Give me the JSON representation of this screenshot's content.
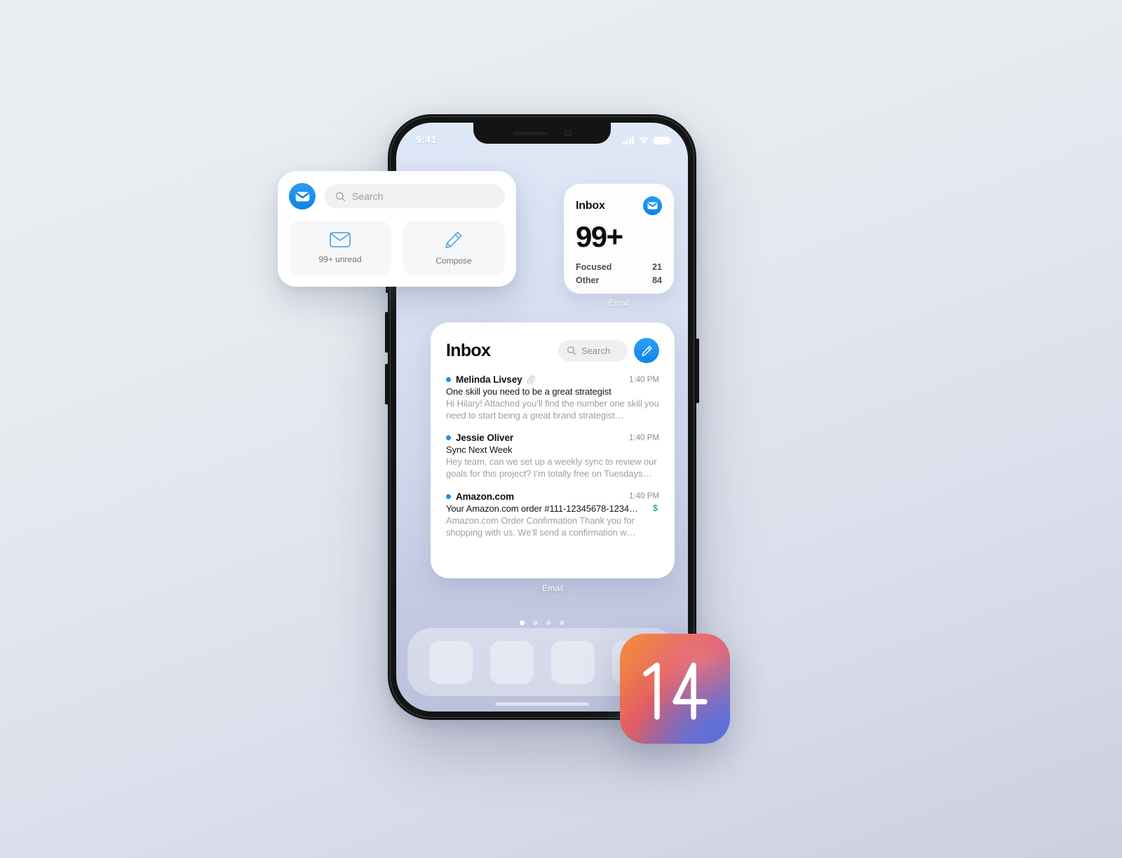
{
  "background": {
    "top_color": "#e9eef1",
    "bottom_color": "#ccd0de"
  },
  "device": {
    "frame_color": "#141414",
    "wallpaper_top": "#dfe8f7",
    "wallpaper_bottom": "#bbc1db",
    "statusbar": {
      "time": "9:41",
      "cellular_icon": "signal-bars-icon",
      "wifi_icon": "wifi-icon",
      "battery_icon": "battery-icon"
    },
    "notch": {
      "speaker_icon": "earpiece-speaker-icon",
      "camera_icon": "front-camera-icon"
    },
    "page_dots": {
      "count": 4,
      "active_index": 0
    },
    "dock": {
      "placeholder_count": 3
    },
    "home_indicator": "home-indicator"
  },
  "accent_colors": {
    "mail_blue": "#0b84e8",
    "unread_dot": "#1c8ef2",
    "dollar_green": "#2eb562"
  },
  "floating_widget": {
    "app_icon": "mail-app-icon",
    "search": {
      "icon": "search-icon",
      "placeholder": "Search"
    },
    "tiles": [
      {
        "icon": "envelope-icon",
        "label": "99+ unread"
      },
      {
        "icon": "pencil-compose-icon",
        "label": "Compose"
      }
    ]
  },
  "inbox_count_widget": {
    "title": "Inbox",
    "app_icon": "mail-app-icon",
    "count": "99+",
    "rows": [
      {
        "label": "Focused",
        "value": "21"
      },
      {
        "label": "Other",
        "value": "84"
      }
    ],
    "widget_label": "Email"
  },
  "inbox_list_widget": {
    "title": "Inbox",
    "search": {
      "icon": "search-icon",
      "placeholder": "Search"
    },
    "compose_button": "pencil-compose-icon",
    "widget_label": "Email",
    "messages": [
      {
        "sender": "Melinda Livsey",
        "attachment_icon": "paperclip-icon",
        "time": "1:40 PM",
        "subject": "One skill you need to be a great strategist",
        "preview": "Hi Hilary! Attached you’ll find the number one skill you need to start being a great brand strategist…",
        "unread": true,
        "flag_icon": ""
      },
      {
        "sender": "Jessie Oliver",
        "attachment_icon": "",
        "time": "1:40 PM",
        "subject": "Sync Next Week",
        "preview": "Hey team, can we set up a weekly sync to review our goals for this project? I’m totally free on Tuesdays…",
        "unread": true,
        "flag_icon": ""
      },
      {
        "sender": "Amazon.com",
        "attachment_icon": "",
        "time": "1:40 PM",
        "subject": "Your Amazon.com order #111-12345678-1234…",
        "preview": "Amazon.com Order Confirmation Thank you for shopping with us. We’ll send a confirmation w…",
        "unread": true,
        "flag_icon": "$"
      }
    ]
  },
  "ios_badge": {
    "version": "14",
    "gradient_from": "#f2913f",
    "gradient_to": "#5f7fd0"
  }
}
